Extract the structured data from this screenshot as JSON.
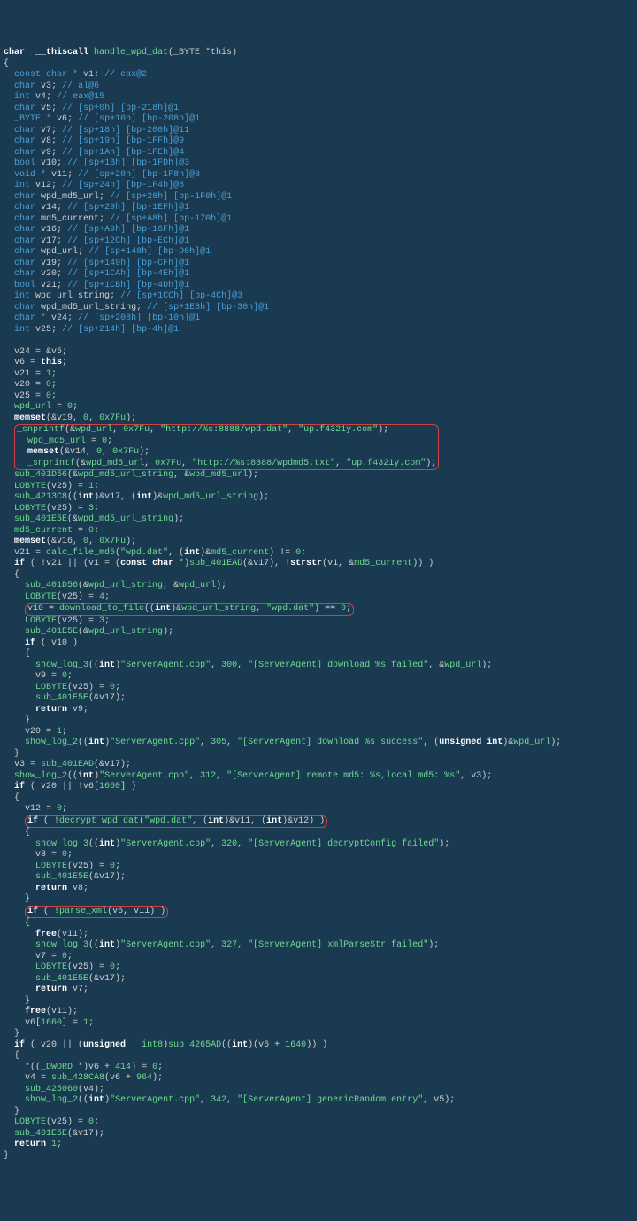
{
  "sig": {
    "pre": "char  __thiscall ",
    "fn": "handle_wpd_dat",
    "args": "(_BYTE *this)"
  },
  "decls": [
    {
      "type": "const char *",
      "name": "v1",
      "cmt": "// eax@2"
    },
    {
      "type": "char",
      "name": "v3",
      "cmt": "// al@6"
    },
    {
      "type": "int",
      "name": "v4",
      "cmt": "// eax@15"
    },
    {
      "type": "char",
      "name": "v5",
      "cmt": "// [sp+0h] [bp-218h]@1"
    },
    {
      "type": "_BYTE *",
      "name": "v6",
      "cmt": "// [sp+10h] [bp-208h]@1"
    },
    {
      "type": "char",
      "name": "v7",
      "cmt": "// [sp+18h] [bp-200h]@11"
    },
    {
      "type": "char",
      "name": "v8",
      "cmt": "// [sp+19h] [bp-1FFh]@9"
    },
    {
      "type": "char",
      "name": "v9",
      "cmt": "// [sp+1Ah] [bp-1FEh]@4"
    },
    {
      "type": "bool",
      "name": "v10",
      "cmt": "// [sp+1Bh] [bp-1FDh]@3"
    },
    {
      "type": "void *",
      "name": "v11",
      "cmt": "// [sp+20h] [bp-1F8h]@8"
    },
    {
      "type": "int",
      "name": "v12",
      "cmt": "// [sp+24h] [bp-1F4h]@8"
    },
    {
      "type": "char",
      "name": "wpd_md5_url",
      "cmt": "// [sp+28h] [bp-1F0h]@1"
    },
    {
      "type": "char",
      "name": "v14",
      "cmt": "// [sp+29h] [bp-1EFh]@1"
    },
    {
      "type": "char",
      "name": "md5_current",
      "cmt": "// [sp+A8h] [bp-170h]@1"
    },
    {
      "type": "char",
      "name": "v16",
      "cmt": "// [sp+A9h] [bp-16Fh]@1"
    },
    {
      "type": "char",
      "name": "v17",
      "cmt": "// [sp+12Ch] [bp-ECh]@1"
    },
    {
      "type": "char",
      "name": "wpd_url",
      "cmt": "// [sp+148h] [bp-D0h]@1"
    },
    {
      "type": "char",
      "name": "v19",
      "cmt": "// [sp+149h] [bp-CFh]@1"
    },
    {
      "type": "char",
      "name": "v20",
      "cmt": "// [sp+1CAh] [bp-4Eh]@1"
    },
    {
      "type": "bool",
      "name": "v21",
      "cmt": "// [sp+1CBh] [bp-4Dh]@1"
    },
    {
      "type": "int",
      "name": "wpd_url_string",
      "cmt": "// [sp+1CCh] [bp-4Ch]@3"
    },
    {
      "type": "char",
      "name": "wpd_md5_url_string",
      "cmt": "// [sp+1E8h] [bp-30h]@1"
    },
    {
      "type": "char *",
      "name": "v24",
      "cmt": "// [sp+208h] [bp-10h]@1"
    },
    {
      "type": "int",
      "name": "v25",
      "cmt": "// [sp+214h] [bp-4h]@1"
    }
  ],
  "l": {
    "a1": "v24 = &v5;",
    "a2": "v6 = this;",
    "a3": "v21 = 1;",
    "a4": "v20 = 0;",
    "a5": "v25 = 0;",
    "a6": "wpd_url = 0;",
    "a7": "memset(&v19, 0, 0x7Fu);",
    "h1a": "_snprintf(&wpd_url, 0x7Fu, \"http://%s:8888/wpd.dat\", \"up.f4321y.com\");",
    "h1b": "wpd_md5_url = 0;",
    "h1c": "memset(&v14, 0, 0x7Fu);",
    "h1d": "_snprintf(&wpd_md5_url, 0x7Fu, \"http://%s:8888/wpdmd5.txt\", \"up.f4321y.com\");",
    "b1": "sub_401D56(&wpd_md5_url_string, &wpd_md5_url);",
    "b2": "LOBYTE(v25) = 1;",
    "b3": "sub_4213C8((int)&v17, (int)&wpd_md5_url_string);",
    "b4": "LOBYTE(v25) = 3;",
    "b5": "sub_401E5E(&wpd_md5_url_string);",
    "b6": "md5_current = 0;",
    "b7": "memset(&v16, 0, 0x7Fu);",
    "b8": "v21 = calc_file_md5(\"wpd.dat\", (int)&md5_current) != 0;",
    "b9": "if ( !v21 || (v1 = (const char *)sub_401EAD(&v17), !strstr(v1, &md5_current)) )",
    "c1": "sub_401D56(&wpd_url_string, &wpd_url);",
    "c2": "LOBYTE(v25) = 4;",
    "h2": "v10 = download_to_file((int)&wpd_url_string, \"wpd.dat\") == 0;",
    "c3": "LOBYTE(v25) = 3;",
    "c4": "sub_401E5E(&wpd_url_string);",
    "c5": "if ( v10 )",
    "d1": "show_log_3((int)\"ServerAgent.cpp\", 300, \"[ServerAgent] download %s failed\", &wpd_url);",
    "d2": "v9 = 0;",
    "d3": "LOBYTE(v25) = 0;",
    "d4": "sub_401E5E(&v17);",
    "d5": "return v9;",
    "e1": "v20 = 1;",
    "e2": "show_log_2((int)\"ServerAgent.cpp\", 305, \"[ServerAgent] download %s success\", (unsigned int)&wpd_url);",
    "f1": "v3 = sub_401EAD(&v17);",
    "f2": "show_log_2((int)\"ServerAgent.cpp\", 312, \"[ServerAgent] remote md5: %s,local md5: %s\", v3);",
    "f3": "if ( v20 || !v6[1660] )",
    "g1": "v12 = 0;",
    "h3": "if ( !decrypt_wpd_dat(\"wpd.dat\", (int)&v11, (int)&v12) )",
    "g2": "show_log_3((int)\"ServerAgent.cpp\", 320, \"[ServerAgent] decryptConfig failed\");",
    "g3": "v8 = 0;",
    "g4": "LOBYTE(v25) = 0;",
    "g5": "sub_401E5E(&v17);",
    "g6": "return v8;",
    "h4": "if ( !parse_xml(v6, v11) )",
    "i1": "free(v11);",
    "i2": "show_log_3((int)\"ServerAgent.cpp\", 327, \"[ServerAgent] xmlParseStr failed\");",
    "i3": "v7 = 0;",
    "i4": "LOBYTE(v25) = 0;",
    "i5": "sub_401E5E(&v17);",
    "i6": "return v7;",
    "j1": "free(v11);",
    "j2": "v6[1660] = 1;",
    "k1": "if ( v20 || (unsigned __int8)sub_4265AD((int)(v6 + 1640)) )",
    "k2": "*((_DWORD *)v6 + 414) = 0;",
    "k3": "v4 = sub_428CA8(v6 + 964);",
    "k4": "sub_425060(v4);",
    "k5": "show_log_2((int)\"ServerAgent.cpp\", 342, \"[ServerAgent] genericRandom entry\", v5);",
    "m1": "LOBYTE(v25) = 0;",
    "m2": "sub_401E5E(&v17);",
    "m3": "return 1;"
  }
}
